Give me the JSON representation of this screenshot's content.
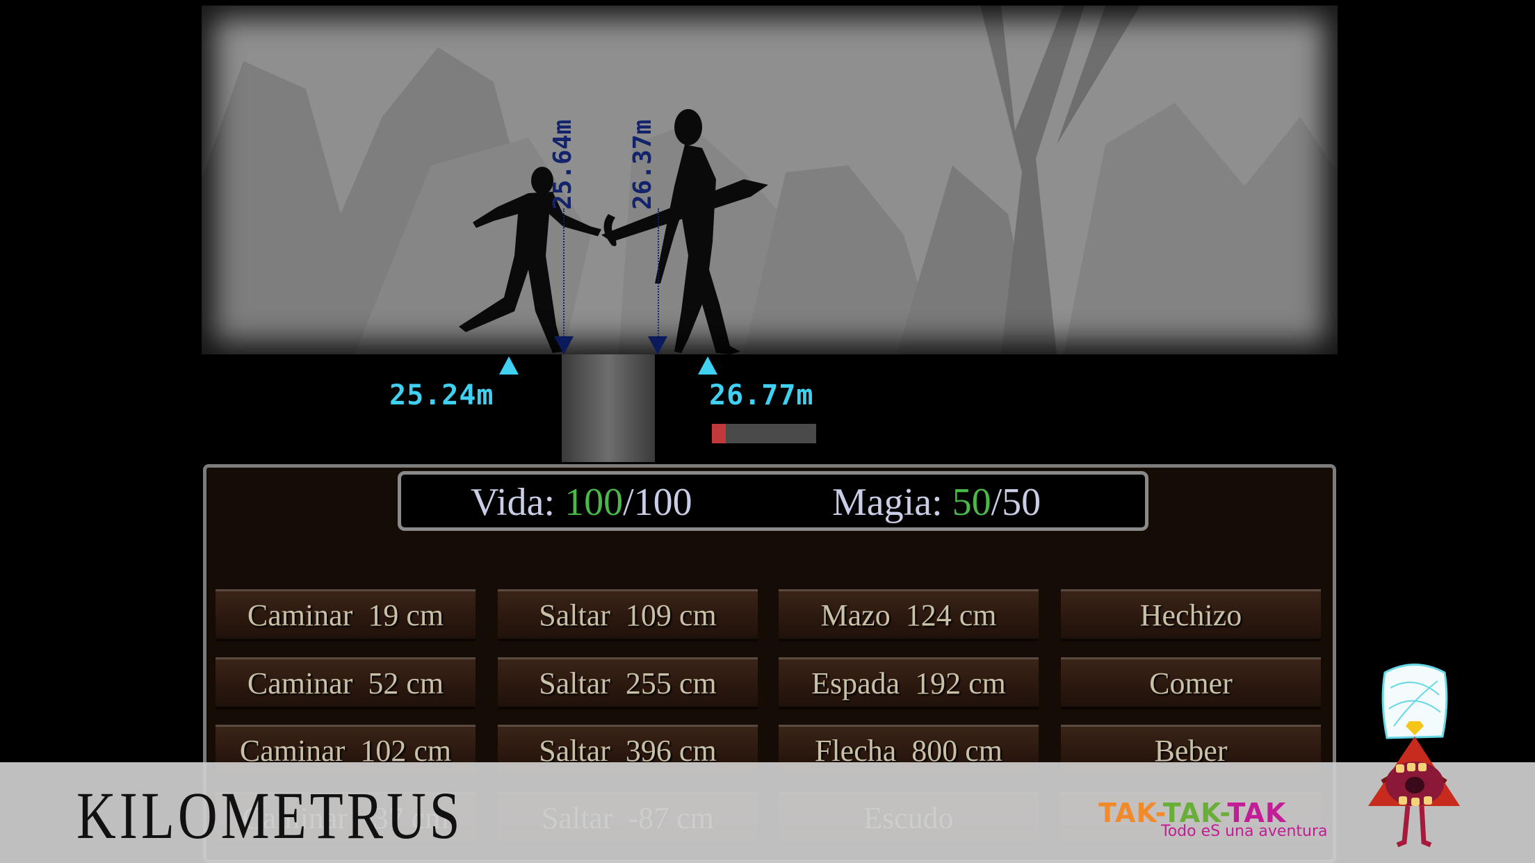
{
  "scene": {
    "player": {
      "ground_distance": "25.24m",
      "weapon_distance": "25.64m"
    },
    "enemy": {
      "ground_distance": "26.77m",
      "weapon_distance": "26.37m",
      "health_fraction": 0.13
    },
    "colors": {
      "distance_label": "#3fd0f2",
      "vertical_label": "#13236b",
      "enemy_health": "#c0393b"
    }
  },
  "stats": {
    "vida_label": "Vida: ",
    "vida_current": "100",
    "vida_max": "/100",
    "magia_label": "Magia: ",
    "magia_current": "50",
    "magia_max": "/50",
    "current_color": "#4bb84a"
  },
  "actions": [
    [
      "Caminar  19 cm",
      "Saltar  109 cm",
      "Mazo  124 cm",
      "Hechizo"
    ],
    [
      "Caminar  52 cm",
      "Saltar  255 cm",
      "Espada  192 cm",
      "Comer"
    ],
    [
      "Caminar  102 cm",
      "Saltar  396 cm",
      "Flecha  800 cm",
      "Beber"
    ],
    [
      "Caminar  -37 cm",
      "Saltar  -87 cm",
      "Escudo",
      ""
    ]
  ],
  "overlay": {
    "title": "KILOMETRUS",
    "publisher_parts": [
      "TAK-",
      "TAK-",
      "TAK"
    ],
    "tagline": "Todo eS una aventura"
  }
}
